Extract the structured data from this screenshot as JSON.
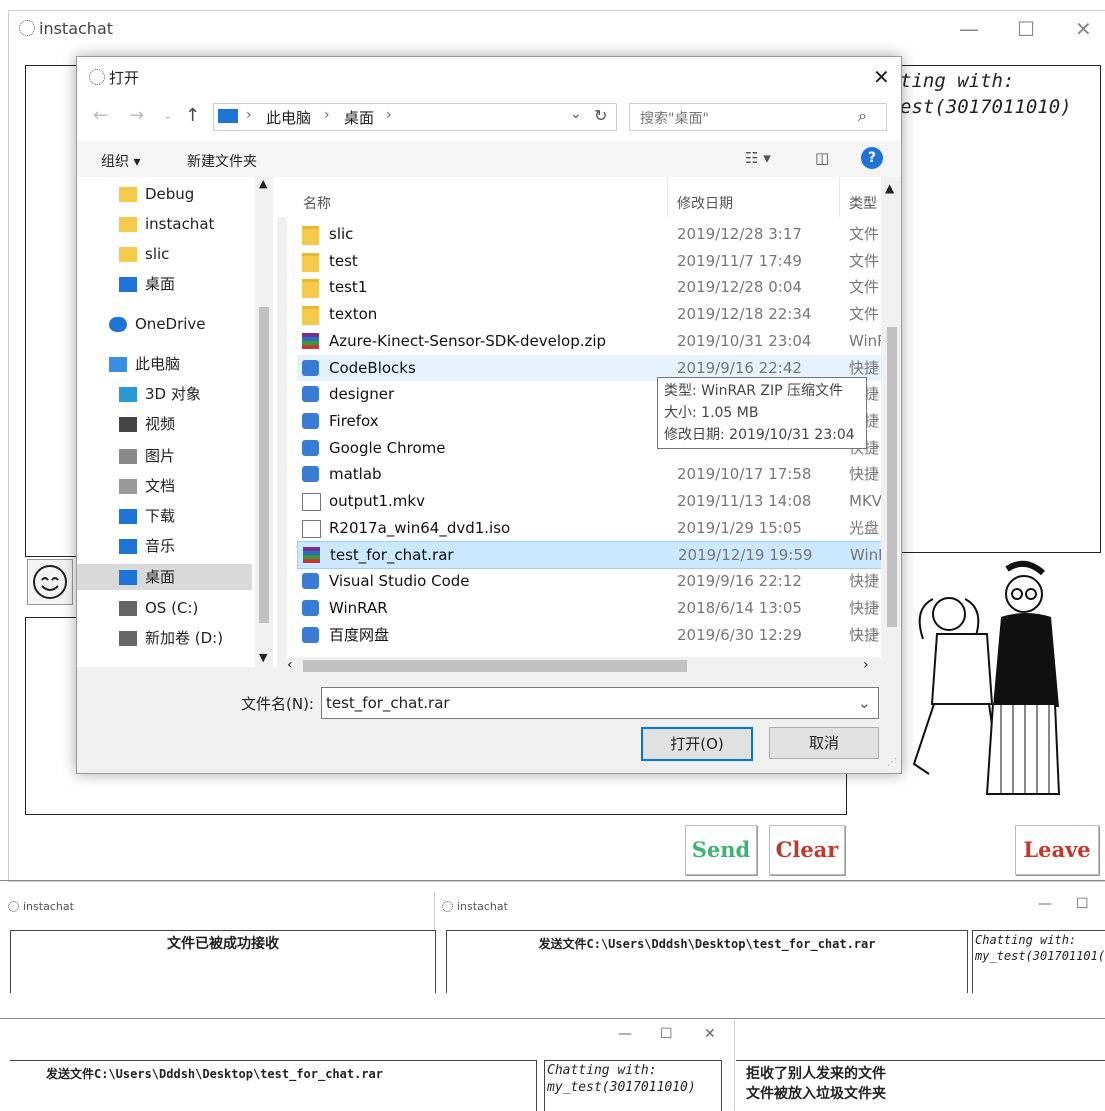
{
  "app": {
    "title": "instachat"
  },
  "chat_with": {
    "line1": "Chatting with:",
    "line2": "test(3017011010)",
    "partial1": "ting with:",
    "partial2": "est(3017011010)"
  },
  "buttons": {
    "send": "Send",
    "clear": "Clear",
    "leave": "Leave"
  },
  "colors": {
    "send": "#3cb371",
    "clear": "#c0392b",
    "leave": "#c0392b",
    "accent": "#0078d7"
  },
  "dialog": {
    "title": "打开",
    "breadcrumb": [
      "此电脑",
      "桌面"
    ],
    "search_placeholder": "搜索\"桌面\"",
    "organize": "组织 ▾",
    "new_folder": "新建文件夹",
    "columns": {
      "name": "名称",
      "date": "修改日期",
      "type": "类型"
    },
    "sidebar": [
      {
        "label": "Debug",
        "icon": "folder-icon"
      },
      {
        "label": "instachat",
        "icon": "folder-icon"
      },
      {
        "label": "slic",
        "icon": "folder-icon"
      },
      {
        "label": "桌面",
        "icon": "desktop-icon"
      },
      {
        "label": "OneDrive",
        "icon": "cloud-icon"
      },
      {
        "label": "此电脑",
        "icon": "computer-icon"
      },
      {
        "label": "3D 对象",
        "icon": "cube-icon"
      },
      {
        "label": "视频",
        "icon": "video-icon"
      },
      {
        "label": "图片",
        "icon": "picture-icon"
      },
      {
        "label": "文档",
        "icon": "document-icon"
      },
      {
        "label": "下载",
        "icon": "download-icon"
      },
      {
        "label": "音乐",
        "icon": "music-icon"
      },
      {
        "label": "桌面",
        "icon": "desktop-icon"
      },
      {
        "label": "OS (C:)",
        "icon": "drive-icon"
      },
      {
        "label": "新加卷 (D:)",
        "icon": "drive-icon"
      }
    ],
    "files": [
      {
        "name": "slic",
        "date": "2019/12/28 3:17",
        "type": "文件",
        "icon": "folder"
      },
      {
        "name": "test",
        "date": "2019/11/7 17:49",
        "type": "文件",
        "icon": "folder"
      },
      {
        "name": "test1",
        "date": "2019/12/28 0:04",
        "type": "文件",
        "icon": "folder"
      },
      {
        "name": "texton",
        "date": "2019/12/18 22:34",
        "type": "文件",
        "icon": "folder"
      },
      {
        "name": "Azure-Kinect-Sensor-SDK-develop.zip",
        "date": "2019/10/31 23:04",
        "type": "WinRAR",
        "icon": "rar"
      },
      {
        "name": "CodeBlocks",
        "date": "2019/9/16 22:42",
        "type": "快捷",
        "icon": "app"
      },
      {
        "name": "designer",
        "date": "",
        "type": "快捷",
        "icon": "app"
      },
      {
        "name": "Firefox",
        "date": "",
        "type": "快捷",
        "icon": "app"
      },
      {
        "name": "Google Chrome",
        "date": "",
        "type": "快捷",
        "icon": "app"
      },
      {
        "name": "matlab",
        "date": "2019/10/17 17:58",
        "type": "快捷",
        "icon": "app"
      },
      {
        "name": "output1.mkv",
        "date": "2019/11/13 14:08",
        "type": "MKV",
        "icon": "file"
      },
      {
        "name": "R2017a_win64_dvd1.iso",
        "date": "2019/1/29 15:05",
        "type": "光盘",
        "icon": "file"
      },
      {
        "name": "test_for_chat.rar",
        "date": "2019/12/19 19:59",
        "type": "WinRAR",
        "icon": "rar"
      },
      {
        "name": "Visual Studio Code",
        "date": "2019/9/16 22:12",
        "type": "快捷",
        "icon": "app"
      },
      {
        "name": "WinRAR",
        "date": "2018/6/14 13:05",
        "type": "快捷",
        "icon": "app"
      },
      {
        "name": "百度网盘",
        "date": "2019/6/30 12:29",
        "type": "快捷",
        "icon": "app"
      }
    ],
    "tooltip": {
      "type": "类型: WinRAR ZIP 压缩文件",
      "size": "大小: 1.05 MB",
      "modified": "修改日期: 2019/10/31 23:04"
    },
    "filename_label": "文件名(N):",
    "filename_value": "test_for_chat.rar",
    "open_button": "打开(O)",
    "cancel_button": "取消"
  },
  "snippets": {
    "received": "文件已被成功接收",
    "sent": "发送文件C:\\Users\\Dddsh\\Desktop\\test_for_chat.rar",
    "chat_with_line1": "Chatting with:",
    "chat_with_line2_a": "my_test(301701101(",
    "chat_with_line2_b": "my_test(3017011010)",
    "rejected_line1": "拒收了别人发来的文件",
    "rejected_line2": "文件被放入垃圾文件夹"
  }
}
